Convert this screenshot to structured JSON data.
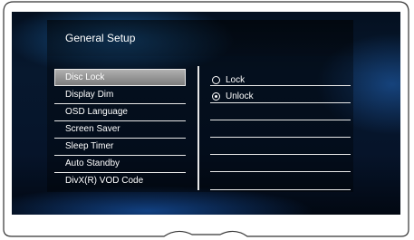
{
  "window": {
    "title": "General Setup"
  },
  "menu": {
    "items": [
      {
        "label": "Disc Lock",
        "selected": true
      },
      {
        "label": "Display Dim",
        "selected": false
      },
      {
        "label": "OSD Language",
        "selected": false
      },
      {
        "label": "Screen Saver",
        "selected": false
      },
      {
        "label": "Sleep Timer",
        "selected": false
      },
      {
        "label": "Auto Standby",
        "selected": false
      },
      {
        "label": "DivX(R) VOD Code",
        "selected": false
      }
    ]
  },
  "options": {
    "items": [
      {
        "label": "Lock",
        "checked": false
      },
      {
        "label": "Unlock",
        "checked": true
      }
    ]
  },
  "colors": {
    "screen_background": "#06142a",
    "selected_highlight": "#9a9a9a",
    "text": "#ffffff",
    "lines": "#e8e8e8"
  }
}
